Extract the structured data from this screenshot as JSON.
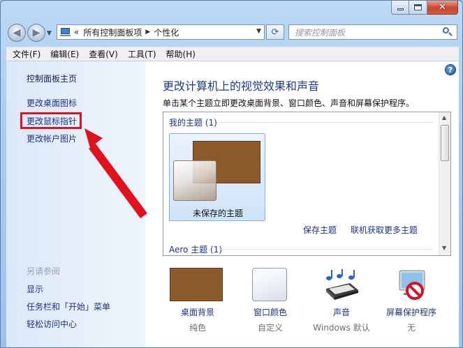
{
  "window": {
    "minimize": "—",
    "maximize": "□",
    "close": "✕"
  },
  "address": {
    "overflow": "«",
    "crumbs": [
      "所有控制面板项",
      "个性化"
    ],
    "search_placeholder": "搜索控制面板"
  },
  "menu": [
    "文件(F)",
    "编辑(E)",
    "查看(V)",
    "工具(T)",
    "帮助(H)"
  ],
  "sidebar": {
    "home": "控制面板主页",
    "links": [
      "更改桌面图标",
      "更改鼠标指针",
      "更改帐户图片"
    ],
    "see_also_title": "另请参阅",
    "see_also": [
      "显示",
      "任务栏和「开始」菜单",
      "轻松访问中心"
    ]
  },
  "main": {
    "help": "?",
    "title": "更改计算机上的视觉效果和声音",
    "description": "单击某个主题立即更改桌面背景、窗口颜色、声音和屏幕保护程序。",
    "my_themes": "我的主题 (1)",
    "unsaved_theme": "未保存的主题",
    "save_theme": "保存主题",
    "online_themes": "联机获取更多主题",
    "aero_themes": "Aero 主题 (1)"
  },
  "bottom": [
    {
      "label": "桌面背景",
      "sub": "纯色",
      "icon": "desktop-background-swatch"
    },
    {
      "label": "窗口颜色",
      "sub": "自定义",
      "icon": "window-color-swatch"
    },
    {
      "label": "声音",
      "sub": "Windows 默认",
      "icon": "sound-notes-icon"
    },
    {
      "label": "屏幕保护程序",
      "sub": "无",
      "icon": "screensaver-none-icon"
    }
  ],
  "colors": {
    "link": "#1e3287",
    "annotation_red": "#e0121e",
    "theme_brown": "#8a5a2b"
  }
}
